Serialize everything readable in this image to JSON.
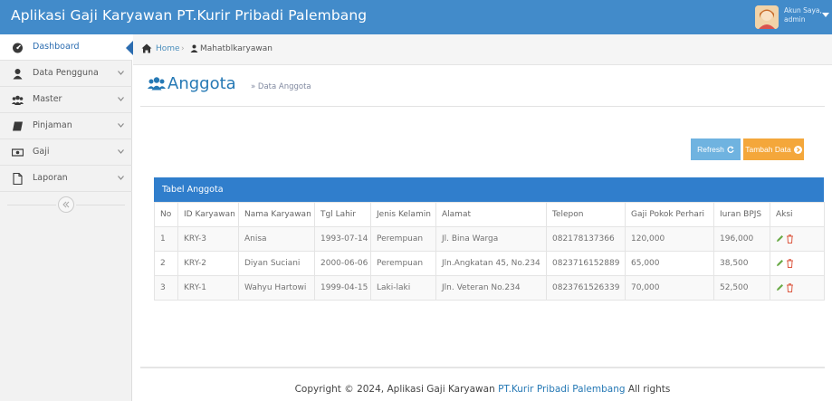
{
  "app": {
    "title": "Aplikasi Gaji Karyawan PT.Kurir Pribadi Palembang",
    "accent_color": "#428bca"
  },
  "user": {
    "line1": "Akun Saya,",
    "line2": "admin",
    "avatar_icon": "user-avatar-icon"
  },
  "sidebar": {
    "items": [
      {
        "label": "Dashboard",
        "icon": "dashboard-icon",
        "active": true
      },
      {
        "label": "Data Pengguna",
        "icon": "user-icon",
        "expandable": true
      },
      {
        "label": "Master",
        "icon": "users-icon",
        "expandable": true
      },
      {
        "label": "Pinjaman",
        "icon": "book-icon",
        "expandable": true
      },
      {
        "label": "Gaji",
        "icon": "money-icon",
        "expandable": true
      },
      {
        "label": "Laporan",
        "icon": "file-icon",
        "expandable": true
      }
    ],
    "collapse_icon": "double-chevron-left-icon"
  },
  "breadcrumb": {
    "home": "Home",
    "separator": "›",
    "current": "Mahatblkaryawan"
  },
  "page": {
    "title": "Anggota",
    "subtitle": "» Data Anggota"
  },
  "buttons": {
    "refresh": "Refresh",
    "add": "Tambah Data"
  },
  "table": {
    "title": "Tabel Anggota",
    "columns": [
      "No",
      "ID Karyawan",
      "Nama Karyawan",
      "Tgl Lahir",
      "Jenis Kelamin",
      "Alamat",
      "Telepon",
      "Gaji Pokok Perhari",
      "Iuran BPJS",
      "Aksi"
    ],
    "rows": [
      [
        "1",
        "KRY-3",
        "Anisa",
        "1993-07-14",
        "Perempuan",
        "Jl. Bina Warga",
        "082178137366",
        "120,000",
        "196,000"
      ],
      [
        "2",
        "KRY-2",
        "Diyan Suciani",
        "2000-06-06",
        "Perempuan",
        "Jln.Angkatan 45, No.234",
        "0823716152889",
        "65,000",
        "38,500"
      ],
      [
        "3",
        "KRY-1",
        "Wahyu Hartowi",
        "1999-04-15",
        "Laki-laki",
        "Jln. Veteran No.234",
        "0823761526339",
        "70,000",
        "52,500"
      ]
    ]
  },
  "footer": {
    "prefix": "Copyright © 2024, Aplikasi Gaji Karyawan",
    "brand": "PT.Kurir Pribadi Palembang",
    "suffix": "All rights"
  }
}
